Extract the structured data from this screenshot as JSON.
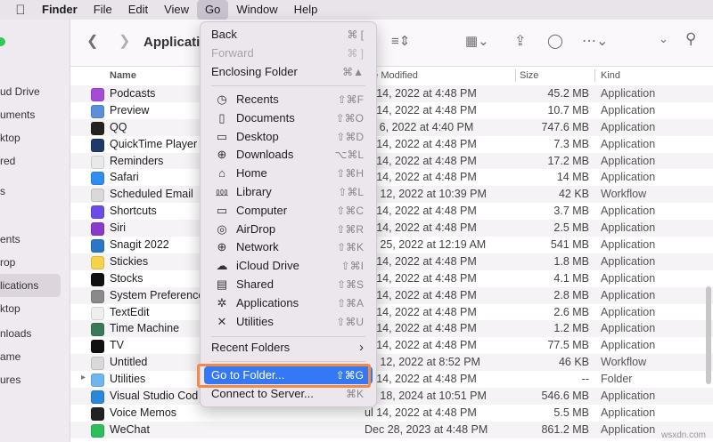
{
  "menubar": {
    "items": [
      "Finder",
      "File",
      "Edit",
      "View",
      "Go",
      "Window",
      "Help"
    ],
    "active": "Go"
  },
  "sidebar": {
    "items": [
      {
        "label": "ud Drive"
      },
      {
        "label": "uments"
      },
      {
        "label": "ktop"
      },
      {
        "label": "red"
      },
      {
        "label": "s"
      },
      {
        "label": "ents"
      },
      {
        "label": "rop"
      },
      {
        "label": "lications",
        "selected": true
      },
      {
        "label": "ktop"
      },
      {
        "label": "nloads"
      },
      {
        "label": "ame"
      },
      {
        "label": "ures"
      }
    ]
  },
  "toolbar": {
    "title": "Applicatio"
  },
  "columns": {
    "name": "Name",
    "date": "ate Modified",
    "size": "Size",
    "kind": "Kind"
  },
  "files": [
    {
      "name": "Podcasts",
      "date": "ul 14, 2022 at 4:48 PM",
      "size": "45.2 MB",
      "kind": "Application",
      "color": "#a64bd6"
    },
    {
      "name": "Preview",
      "date": "ul 14, 2022 at 4:48 PM",
      "size": "10.7 MB",
      "kind": "Application",
      "color": "#5b8fd8"
    },
    {
      "name": "QQ",
      "date": "ay 6, 2022 at 4:40 PM",
      "size": "747.6 MB",
      "kind": "Application",
      "color": "#222222"
    },
    {
      "name": "QuickTime Player",
      "date": "ul 14, 2022 at 4:48 PM",
      "size": "7.3 MB",
      "kind": "Application",
      "color": "#1d3a6b"
    },
    {
      "name": "Reminders",
      "date": "ul 14, 2022 at 4:48 PM",
      "size": "17.2 MB",
      "kind": "Application",
      "color": "#e9e9e9"
    },
    {
      "name": "Safari",
      "date": "ul 14, 2022 at 4:48 PM",
      "size": "14 MB",
      "kind": "Application",
      "color": "#2f8ff0"
    },
    {
      "name": "Scheduled Email",
      "date": "ep 12, 2022 at 10:39 PM",
      "size": "42 KB",
      "kind": "Workflow",
      "color": "#d9d9d9"
    },
    {
      "name": "Shortcuts",
      "date": "ul 14, 2022 at 4:48 PM",
      "size": "3.7 MB",
      "kind": "Application",
      "color": "#6b4de6"
    },
    {
      "name": "Siri",
      "date": "ul 14, 2022 at 4:48 PM",
      "size": "2.5 MB",
      "kind": "Application",
      "color": "#8a3ac8"
    },
    {
      "name": "Snagit 2022",
      "date": "an 25, 2022 at 12:19 AM",
      "size": "541 MB",
      "kind": "Application",
      "color": "#2b76c6"
    },
    {
      "name": "Stickies",
      "date": "ul 14, 2022 at 4:48 PM",
      "size": "1.8 MB",
      "kind": "Application",
      "color": "#f4d34a"
    },
    {
      "name": "Stocks",
      "date": "ul 14, 2022 at 4:48 PM",
      "size": "4.1 MB",
      "kind": "Application",
      "color": "#111111"
    },
    {
      "name": "System Preference",
      "date": "ul 14, 2022 at 4:48 PM",
      "size": "2.8 MB",
      "kind": "Application",
      "color": "#8a8a8a"
    },
    {
      "name": "TextEdit",
      "date": "ul 14, 2022 at 4:48 PM",
      "size": "2.6 MB",
      "kind": "Application",
      "color": "#efefef"
    },
    {
      "name": "Time Machine",
      "date": "ul 14, 2022 at 4:48 PM",
      "size": "1.2 MB",
      "kind": "Application",
      "color": "#3a7a5a"
    },
    {
      "name": "TV",
      "date": "ul 14, 2022 at 4:48 PM",
      "size": "77.5 MB",
      "kind": "Application",
      "color": "#111111"
    },
    {
      "name": "Untitled",
      "date": "ep 12, 2022 at 8:52 PM",
      "size": "46 KB",
      "kind": "Workflow",
      "color": "#d9d9d9"
    },
    {
      "name": "Utilities",
      "date": "ul 14, 2022 at 4:48 PM",
      "size": "--",
      "kind": "Folder",
      "color": "#6fb6ee",
      "folder": true
    },
    {
      "name": "Visual Studio Cod",
      "date": "an 18, 2024 at 10:51 PM",
      "size": "546.6 MB",
      "kind": "Application",
      "color": "#2b88d8"
    },
    {
      "name": "Voice Memos",
      "date": "ul 14, 2022 at 4:48 PM",
      "size": "5.5 MB",
      "kind": "Application",
      "color": "#222222"
    },
    {
      "name": "WeChat",
      "date": "Dec 28, 2023 at 4:48 PM",
      "size": "861.2 MB",
      "kind": "Application",
      "color": "#2dc05a"
    }
  ],
  "go_menu": {
    "top": [
      {
        "label": "Back",
        "shortcut": "⌘ [",
        "disabled": false
      },
      {
        "label": "Forward",
        "shortcut": "⌘ ]",
        "disabled": true
      },
      {
        "label": "Enclosing Folder",
        "shortcut": "⌘▲",
        "disabled": false
      }
    ],
    "places": [
      {
        "label": "Recents",
        "shortcut": "⇧⌘F",
        "icon": "clock-icon",
        "glyph": "◷"
      },
      {
        "label": "Documents",
        "shortcut": "⇧⌘O",
        "icon": "document-icon",
        "glyph": "▯"
      },
      {
        "label": "Desktop",
        "shortcut": "⇧⌘D",
        "icon": "desktop-icon",
        "glyph": "▭"
      },
      {
        "label": "Downloads",
        "shortcut": "⌥⌘L",
        "icon": "download-icon",
        "glyph": "⊕"
      },
      {
        "label": "Home",
        "shortcut": "⇧⌘H",
        "icon": "home-icon",
        "glyph": "⌂"
      },
      {
        "label": "Library",
        "shortcut": "⇧⌘L",
        "icon": "library-icon",
        "glyph": "⅏"
      },
      {
        "label": "Computer",
        "shortcut": "⇧⌘C",
        "icon": "laptop-icon",
        "glyph": "▭"
      },
      {
        "label": "AirDrop",
        "shortcut": "⇧⌘R",
        "icon": "airdrop-icon",
        "glyph": "◎"
      },
      {
        "label": "Network",
        "shortcut": "⇧⌘K",
        "icon": "globe-icon",
        "glyph": "⊕"
      },
      {
        "label": "iCloud Drive",
        "shortcut": "⇧⌘I",
        "icon": "cloud-icon",
        "glyph": "☁"
      },
      {
        "label": "Shared",
        "shortcut": "⇧⌘S",
        "icon": "shared-folder-icon",
        "glyph": "▤"
      },
      {
        "label": "Applications",
        "shortcut": "⇧⌘A",
        "icon": "applications-icon",
        "glyph": "✲"
      },
      {
        "label": "Utilities",
        "shortcut": "⇧⌘U",
        "icon": "utilities-icon",
        "glyph": "✕"
      }
    ],
    "recent_folders": "Recent Folders",
    "recent_arrow": "›",
    "go_to_folder": {
      "label": "Go to Folder...",
      "shortcut": "⇧⌘G"
    },
    "connect": {
      "label": "Connect to Server...",
      "shortcut": "⌘K"
    }
  },
  "watermark": "wsxdn.com"
}
